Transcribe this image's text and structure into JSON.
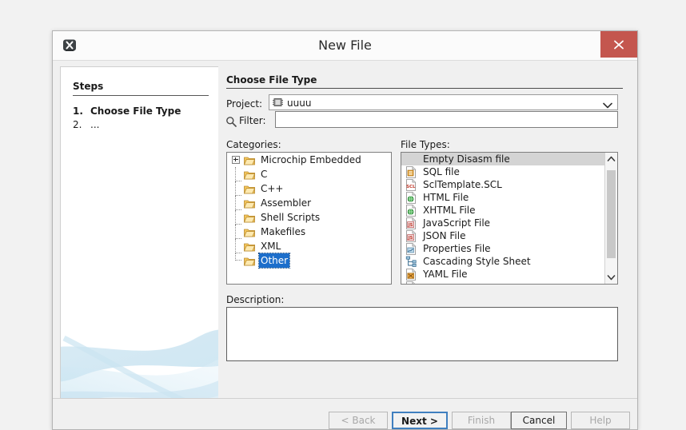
{
  "window": {
    "title": "New File",
    "icon": "mplab-x-icon",
    "close_label": "✕"
  },
  "steps": {
    "heading": "Steps",
    "items": [
      {
        "num": "1.",
        "label": "Choose File Type"
      },
      {
        "num": "2.",
        "label": "..."
      }
    ]
  },
  "main": {
    "section_title": "Choose File Type",
    "project": {
      "label": "Project:",
      "value": "uuuu",
      "icon": "chip-icon",
      "arrow": "chevron-down-icon"
    },
    "filter": {
      "label": "Filter:",
      "value": "",
      "placeholder": "",
      "icon": "search-icon"
    },
    "categories": {
      "label": "Categories:",
      "items": [
        {
          "label": "Microchip Embedded",
          "expandable": true,
          "selected": false
        },
        {
          "label": "C",
          "expandable": false,
          "selected": false
        },
        {
          "label": "C++",
          "expandable": false,
          "selected": false
        },
        {
          "label": "Assembler",
          "expandable": false,
          "selected": false
        },
        {
          "label": "Shell Scripts",
          "expandable": false,
          "selected": false
        },
        {
          "label": "Makefiles",
          "expandable": false,
          "selected": false
        },
        {
          "label": "XML",
          "expandable": false,
          "selected": false
        },
        {
          "label": "Other",
          "expandable": false,
          "selected": true
        }
      ]
    },
    "file_types": {
      "label": "File Types:",
      "items": [
        {
          "label": "Empty Disasm file",
          "icon": "blank-file-icon",
          "selected": true
        },
        {
          "label": "SQL file",
          "icon": "sql-file-icon",
          "selected": false
        },
        {
          "label": "SclTemplate.SCL",
          "icon": "scl-file-icon",
          "selected": false
        },
        {
          "label": "HTML File",
          "icon": "html-file-icon",
          "selected": false
        },
        {
          "label": "XHTML File",
          "icon": "xhtml-file-icon",
          "selected": false
        },
        {
          "label": "JavaScript File",
          "icon": "javascript-file-icon",
          "selected": false
        },
        {
          "label": "JSON File",
          "icon": "json-file-icon",
          "selected": false
        },
        {
          "label": "Properties File",
          "icon": "properties-file-icon",
          "selected": false
        },
        {
          "label": "Cascading Style Sheet",
          "icon": "css-file-icon",
          "selected": false
        },
        {
          "label": "YAML File",
          "icon": "yaml-file-icon",
          "selected": false
        },
        {
          "label": "",
          "icon": "generic-file-icon",
          "selected": false
        }
      ],
      "scroll": {
        "up_arrow": "chevron-up-icon",
        "down_arrow": "chevron-down-icon"
      }
    },
    "description": {
      "label": "Description:",
      "value": ""
    }
  },
  "footer": {
    "buttons": [
      {
        "label": "< Back",
        "state": "disabled"
      },
      {
        "label": "Next >",
        "state": "default"
      },
      {
        "label": "Finish",
        "state": "disabled"
      },
      {
        "label": "Cancel",
        "state": "enabled"
      },
      {
        "label": "Help",
        "state": "disabled"
      }
    ]
  },
  "colors": {
    "close_red": "#c4564e",
    "selection_blue": "#1c6ecb",
    "selection_grey": "#d4d4d4",
    "default_button_border": "#3f7fbf",
    "dialog_bg": "#f0f0f0",
    "desktop_bg": "#f2f2f2"
  }
}
